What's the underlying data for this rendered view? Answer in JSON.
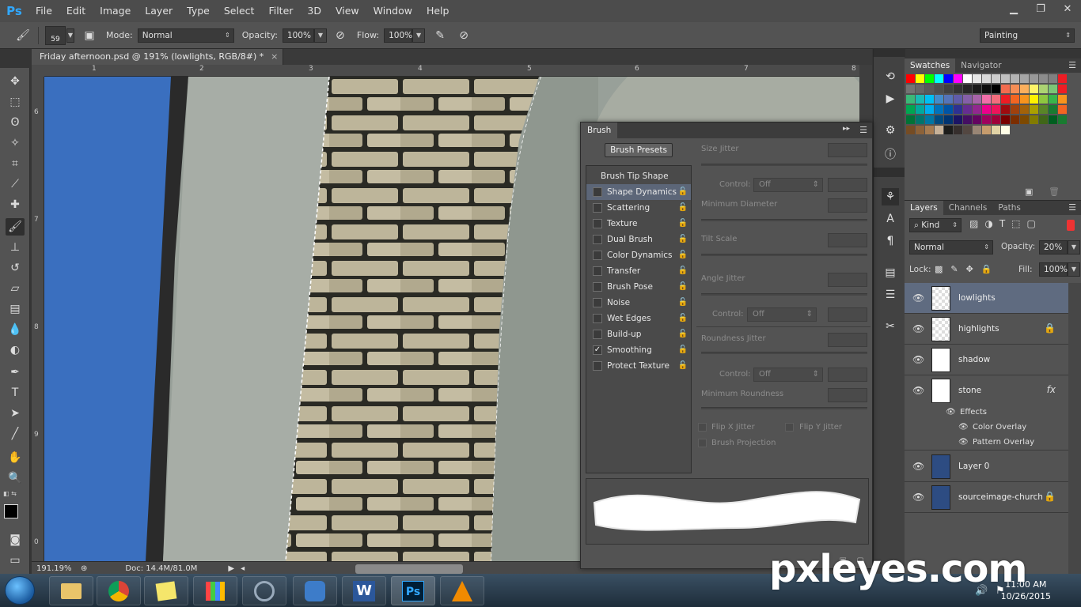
{
  "menubar": {
    "logo": "Ps",
    "items": [
      "File",
      "Edit",
      "Image",
      "Layer",
      "Type",
      "Select",
      "Filter",
      "3D",
      "View",
      "Window",
      "Help"
    ]
  },
  "options": {
    "brush_size": "59",
    "mode_label": "Mode:",
    "mode_value": "Normal",
    "opacity_label": "Opacity:",
    "opacity_value": "100%",
    "flow_label": "Flow:",
    "flow_value": "100%",
    "workspace": "Painting"
  },
  "document": {
    "tab_title": "Friday afternoon.psd @ 191% (lowlights, RGB/8#) *",
    "ruler_h": [
      "1",
      "2",
      "3",
      "4",
      "5",
      "6",
      "7",
      "8"
    ],
    "ruler_v": [
      "6",
      "7",
      "8",
      "9",
      "0"
    ]
  },
  "status": {
    "zoom": "191.19%",
    "doc_info": "Doc: 14.4M/81.0M"
  },
  "swatches": {
    "tabs": [
      "Swatches",
      "Navigator"
    ],
    "colors_row1": [
      "#ff0000",
      "#ffff00",
      "#00ff00",
      "#00ffff",
      "#0000ff",
      "#ff00ff",
      "#ffffff",
      "#e6e6e6",
      "#d9d9d9",
      "#cccccc",
      "#bfbfbf",
      "#b3b3b3",
      "#a6a6a6",
      "#999999",
      "#8c8c8c",
      "#808080",
      "#ed1c24"
    ],
    "colors_row2": [
      "#737373",
      "#666666",
      "#595959",
      "#4d4d4d",
      "#404040",
      "#333333",
      "#262626",
      "#1a1a1a",
      "#0d0d0d",
      "#000000",
      "#f26c4f",
      "#f68e56",
      "#fbaf5c",
      "#fff468",
      "#acd372",
      "#7cc576",
      "#ee1d24"
    ],
    "colors_row3": [
      "#3bb878",
      "#1abbb4",
      "#00bff3",
      "#438ccb",
      "#5574b9",
      "#605ca9",
      "#855fa8",
      "#a763a9",
      "#f06ea9",
      "#f26d7d",
      "#ed1c24",
      "#f26522",
      "#f7941d",
      "#fff200",
      "#8dc63f",
      "#39b54a",
      "#f7941d"
    ],
    "colors_row4": [
      "#00a651",
      "#00a99d",
      "#00aeef",
      "#0072bc",
      "#0054a6",
      "#2e3192",
      "#662d91",
      "#92278f",
      "#ec008c",
      "#ed145b",
      "#9e0b0f",
      "#a0410d",
      "#a36209",
      "#aba000",
      "#598527",
      "#1a7b30",
      "#f26522"
    ],
    "colors_row5": [
      "#007236",
      "#00746b",
      "#0076a3",
      "#004a80",
      "#003471",
      "#1b1464",
      "#440e62",
      "#630460",
      "#9e005d",
      "#9e0039",
      "#790000",
      "#7b2e00",
      "#7d4900",
      "#827b00",
      "#406618",
      "#005e20",
      "#197b30"
    ],
    "colors_row6": [
      "#754c24",
      "#8c6239",
      "#a67c52",
      "#c7b299",
      "#1d1d1b",
      "#362f2d",
      "#534741",
      "#998675",
      "#c69c6d",
      "#e1d3a5",
      "#fffde6"
    ]
  },
  "layers": {
    "tabs": [
      "Layers",
      "Channels",
      "Paths"
    ],
    "filter_kind": "Kind",
    "blend_mode": "Normal",
    "opacity_label": "Opacity:",
    "opacity_value": "20%",
    "lock_label": "Lock:",
    "fill_label": "Fill:",
    "fill_value": "100%",
    "items": [
      {
        "name": "lowlights"
      },
      {
        "name": "highlights"
      },
      {
        "name": "shadow"
      },
      {
        "name": "stone"
      },
      {
        "name": "Layer 0"
      },
      {
        "name": "sourceimage-church"
      }
    ],
    "effects_label": "Effects",
    "effects": [
      "Color Overlay",
      "Pattern Overlay"
    ],
    "fx_badge": "fx"
  },
  "brush": {
    "tab": "Brush",
    "presets_button": "Brush Presets",
    "tip_shape": "Brush Tip Shape",
    "options": [
      {
        "label": "Shape Dynamics",
        "checked": ""
      },
      {
        "label": "Scattering",
        "checked": ""
      },
      {
        "label": "Texture",
        "checked": ""
      },
      {
        "label": "Dual Brush",
        "checked": ""
      },
      {
        "label": "Color Dynamics",
        "checked": ""
      },
      {
        "label": "Transfer",
        "checked": ""
      },
      {
        "label": "Brush Pose",
        "checked": ""
      },
      {
        "label": "Noise",
        "checked": ""
      },
      {
        "label": "Wet Edges",
        "checked": ""
      },
      {
        "label": "Build-up",
        "checked": ""
      },
      {
        "label": "Smoothing",
        "checked": "✓"
      },
      {
        "label": "Protect Texture",
        "checked": ""
      }
    ],
    "size_jitter": "Size Jitter",
    "control_label": "Control:",
    "control_value": "Off",
    "min_diameter": "Minimum Diameter",
    "tilt_scale": "Tilt Scale",
    "angle_jitter": "Angle Jitter",
    "roundness_jitter": "Roundness Jitter",
    "min_roundness": "Minimum Roundness",
    "flip_x": "Flip X Jitter",
    "flip_y": "Flip Y Jitter",
    "projection": "Brush Projection"
  },
  "taskbar": {
    "time": "11:00 AM",
    "date": "10/26/2015"
  },
  "watermark": "pxleyes.com"
}
